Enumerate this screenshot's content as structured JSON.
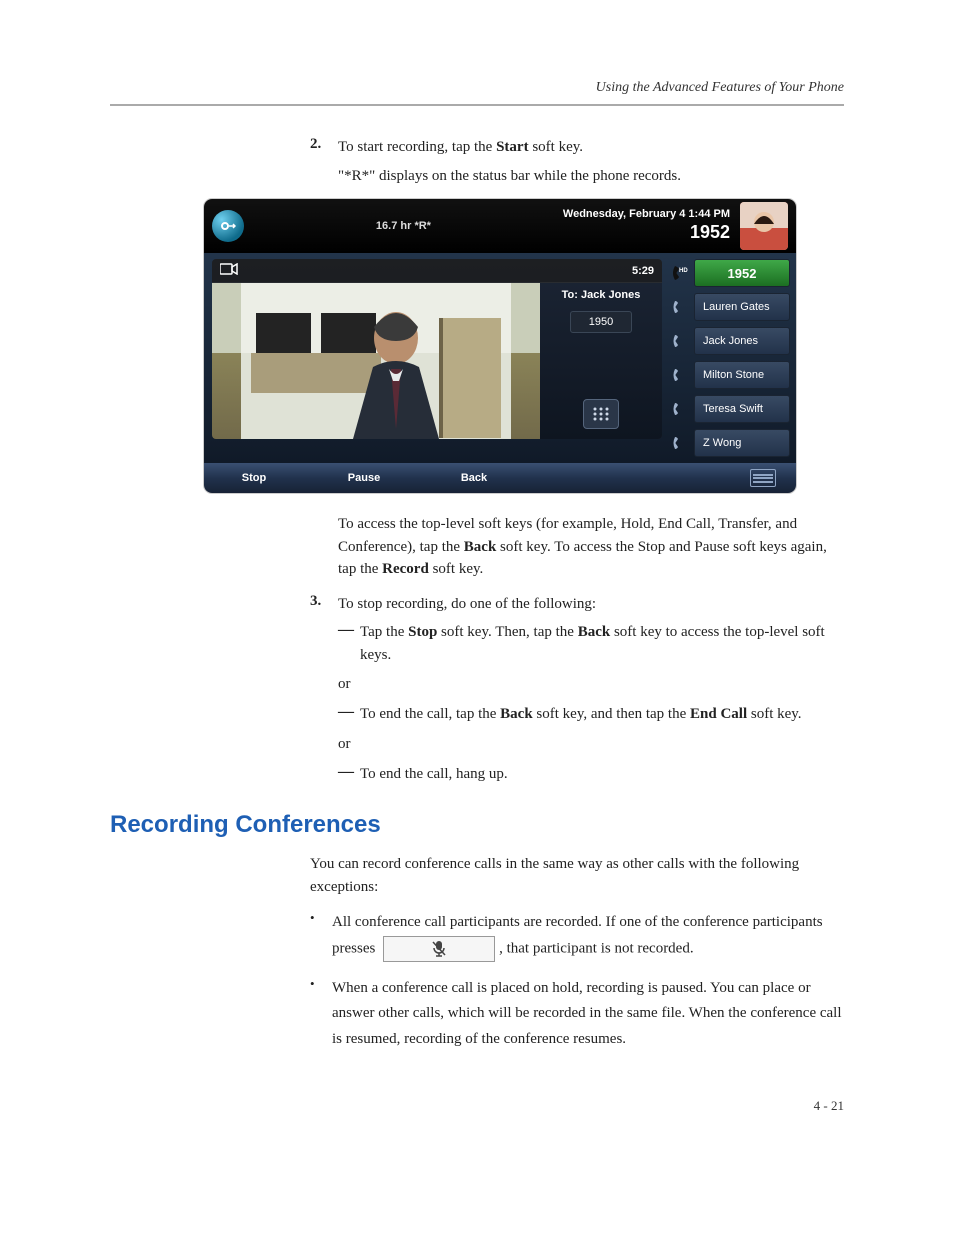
{
  "running_head": "Using the Advanced Features of Your Phone",
  "step2": {
    "num": "2.",
    "line1_a": "To start recording, tap the ",
    "line1_b": "Start",
    "line1_c": " soft key.",
    "line2": "\"*R*\" displays on the status bar while the phone records."
  },
  "screenshot": {
    "status_center": "16.7 hr  *R*",
    "date_line": "Wednesday, February 4  1:44 PM",
    "extension": "1952",
    "call_timer": "5:29",
    "to_label": "To: Jack Jones",
    "to_number": "1950",
    "side_active": "1952",
    "contacts": [
      "Lauren Gates",
      "Jack Jones",
      "Milton Stone",
      "Teresa Swift",
      "Z Wong"
    ],
    "softkeys": {
      "stop": "Stop",
      "pause": "Pause",
      "back": "Back"
    }
  },
  "para_after_shot": {
    "a": "To access the top-level soft keys (for example, Hold, End Call, Transfer, and Conference), tap the ",
    "b": "Back",
    "c": " soft key. To access the Stop and Pause soft keys again, tap the ",
    "d": "Record",
    "e": " soft key."
  },
  "step3": {
    "num": "3.",
    "intro": "To stop recording, do one of the following:",
    "opt1_a": "Tap the ",
    "opt1_b": "Stop",
    "opt1_c": " soft key. Then, tap the ",
    "opt1_d": "Back",
    "opt1_e": " soft key to access the top-level soft keys.",
    "or": "or",
    "opt2_a": "To end the call, tap the ",
    "opt2_b": "Back",
    "opt2_c": " soft key, and then tap the ",
    "opt2_d": "End Call",
    "opt2_e": " soft key.",
    "opt3": "To end the call, hang up."
  },
  "section_heading": "Recording Conferences",
  "conf_intro": "You can record conference calls in the same way as other calls with the following exceptions:",
  "conf_b1_a": "All conference call participants are recorded. If one of the conference participants presses ",
  "conf_b1_b": ", that participant is not recorded.",
  "conf_b2": "When a conference call is placed on hold, recording is paused. You can place or answer other calls, which will be recorded in the same file. When the conference call is resumed, recording of the conference resumes.",
  "pagenum": "4 - 21",
  "dash": "—",
  "bullet": "•"
}
